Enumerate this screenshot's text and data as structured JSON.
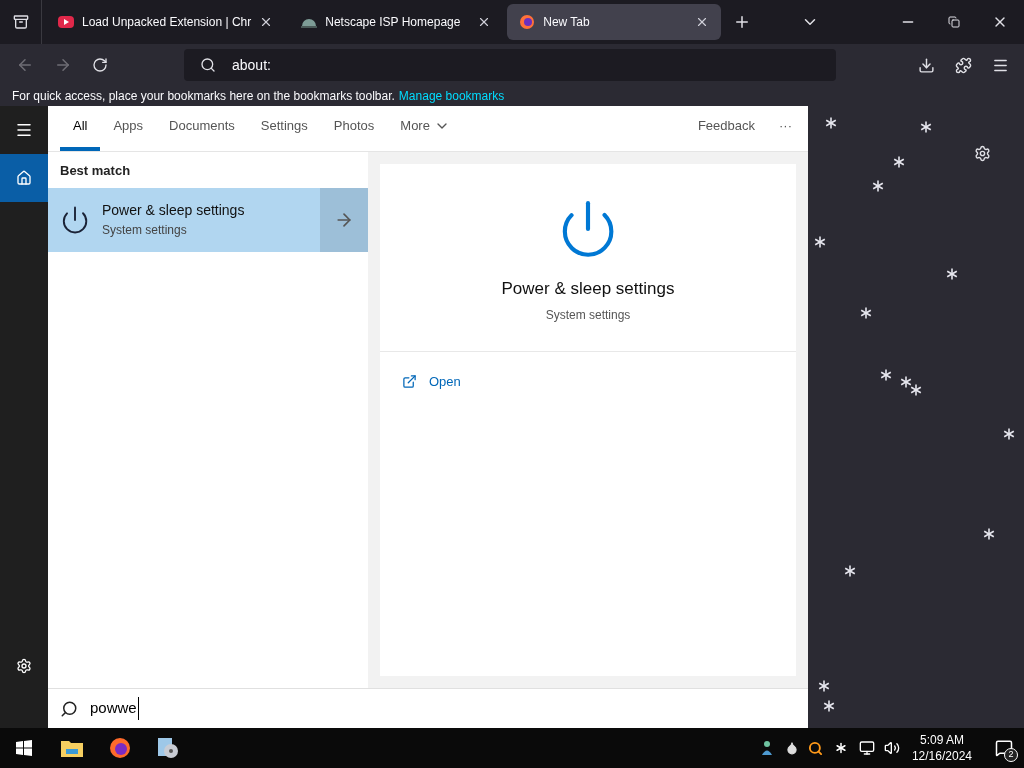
{
  "browser": {
    "tabs": [
      {
        "title": "Load Unpacked Extension | Chr",
        "kind": "video",
        "selected": false
      },
      {
        "title": "Netscape ISP Homepage",
        "kind": "dome",
        "selected": false
      },
      {
        "title": "New Tab",
        "kind": "fox",
        "selected": true
      }
    ],
    "address": {
      "value": "about:"
    },
    "bookmarks_bar": {
      "text": "For quick access, place your bookmarks here on the bookmarks toolbar.",
      "link": "Manage bookmarks"
    }
  },
  "search": {
    "rail": [
      {
        "kind": "menu",
        "selected": false
      },
      {
        "kind": "home",
        "selected": true
      }
    ],
    "tabs": [
      {
        "label": "All",
        "selected": true
      },
      {
        "label": "Apps",
        "selected": false
      },
      {
        "label": "Documents",
        "selected": false
      },
      {
        "label": "Settings",
        "selected": false
      },
      {
        "label": "Photos",
        "selected": false
      }
    ],
    "more": "More",
    "feedback": "Feedback",
    "overflow": "···",
    "section": "Best match",
    "results": [
      {
        "title": "Power & sleep settings",
        "subtitle": "System settings",
        "selected": true
      }
    ],
    "preview": {
      "title": "Power & sleep settings",
      "subtitle": "System settings",
      "actions": [
        "Open"
      ]
    },
    "query": {
      "value": "powwe"
    }
  },
  "taskbar": {
    "apps": [
      {
        "kind": "folder"
      },
      {
        "kind": "fox"
      },
      {
        "kind": "disc"
      }
    ],
    "clock": {
      "time": "5:09 AM",
      "date": "12/16/2024"
    },
    "notifications": {
      "count": "2"
    }
  }
}
